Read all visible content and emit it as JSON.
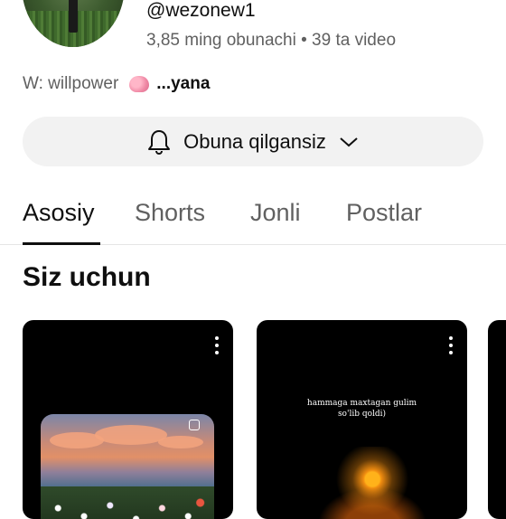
{
  "channel": {
    "handle": "@wezonew1",
    "stats": "3,85 ming obunachi • 39 ta video",
    "description": "W: willpower",
    "more_label": "...yana"
  },
  "subscribe": {
    "label": "Obuna qilgansiz",
    "icon": "bell-icon",
    "chevron_icon": "chevron-down-icon"
  },
  "tabs": [
    {
      "label": "Asosiy",
      "active": true
    },
    {
      "label": "Shorts",
      "active": false
    },
    {
      "label": "Jonli",
      "active": false
    },
    {
      "label": "Postlar",
      "active": false
    }
  ],
  "section": {
    "title": "Siz uchun"
  },
  "cards": [
    {
      "menu_icon": "more-vert-icon",
      "caption": ""
    },
    {
      "menu_icon": "more-vert-icon",
      "caption": "hammaga maxtagan gulim\nso'lib qoldi)"
    }
  ]
}
